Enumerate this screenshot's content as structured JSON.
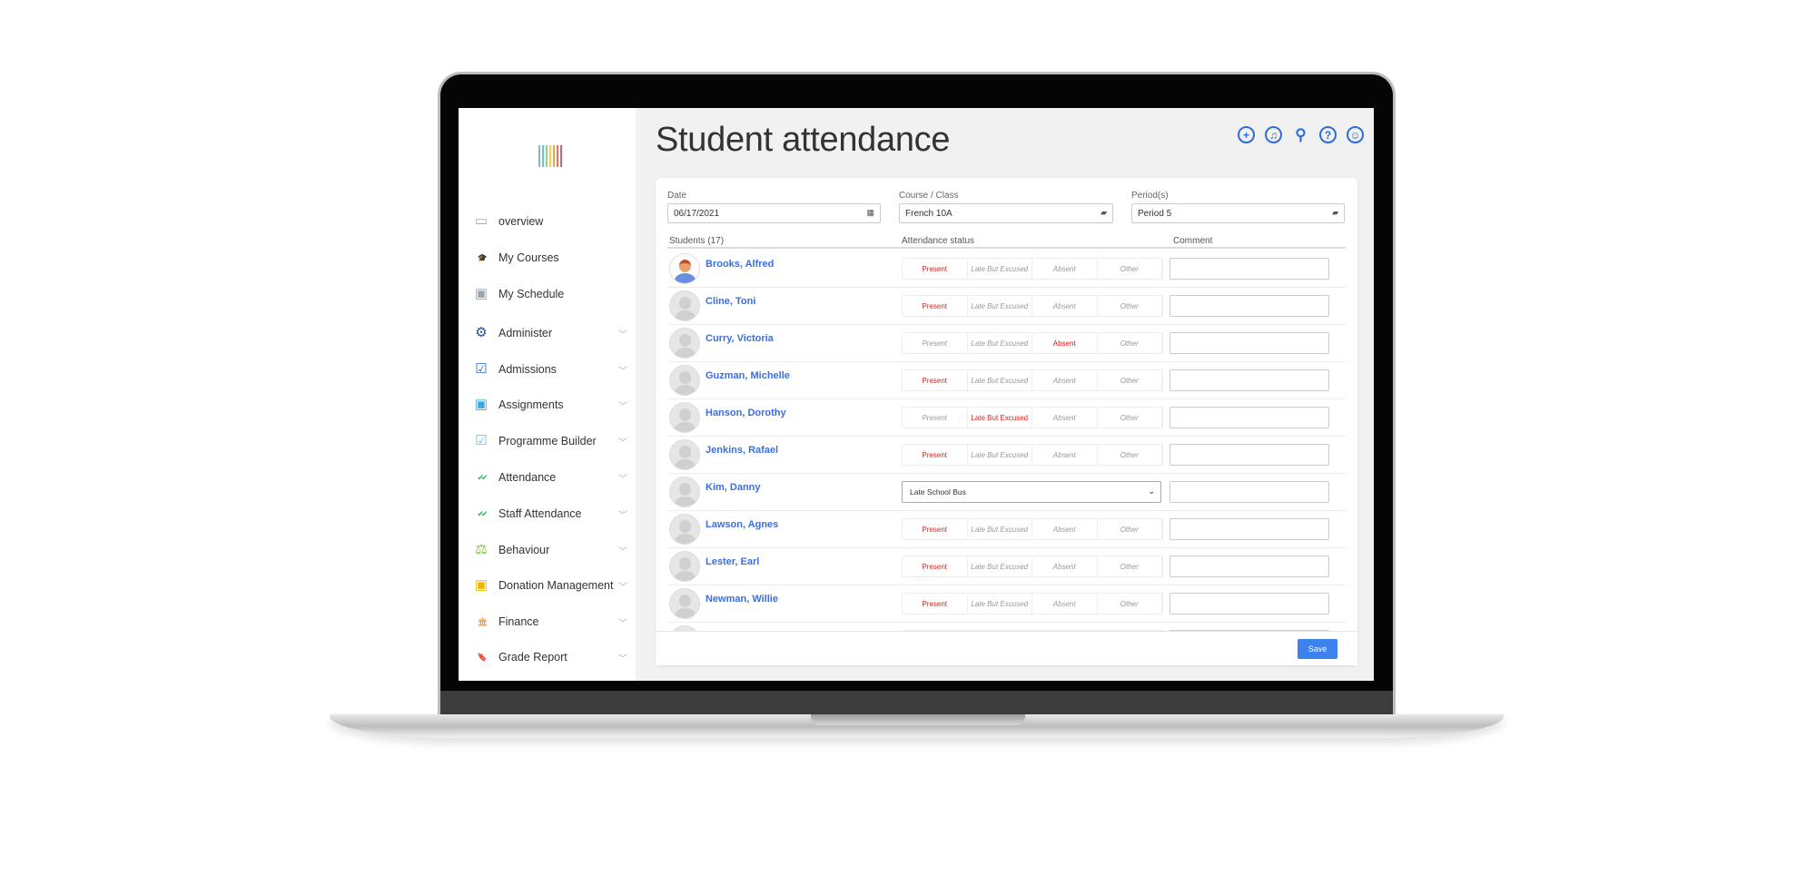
{
  "sidebar": {
    "logo_colors": [
      "#7fb3e8",
      "#5fc7d8",
      "#9bd37a",
      "#f0d050",
      "#f0a050",
      "#e87060",
      "#d06080"
    ],
    "items": [
      {
        "label": "overview",
        "icon": "monitor-icon",
        "glyph": "▭",
        "color": "#9aa4b0",
        "chevron": false
      },
      {
        "label": "My Courses",
        "icon": "graduation-cap-icon",
        "glyph": "🎓",
        "color": "#9aa4b0",
        "chevron": false
      },
      {
        "label": "My Schedule",
        "icon": "calendar-icon",
        "glyph": "▣",
        "color": "#9aa4b0",
        "chevron": false
      },
      {
        "label": "Administer",
        "icon": "gear-icon",
        "glyph": "⚙",
        "color": "#1f4f9a",
        "chevron": true
      },
      {
        "label": "Admissions",
        "icon": "clipboard-check-icon",
        "glyph": "☑",
        "color": "#2e6fd0",
        "chevron": true
      },
      {
        "label": "Assignments",
        "icon": "badge-icon",
        "glyph": "▣",
        "color": "#3aa8d8",
        "chevron": true
      },
      {
        "label": "Programme Builder",
        "icon": "clipboard-check-icon",
        "glyph": "☑",
        "color": "#5ec2ec",
        "chevron": true
      },
      {
        "label": "Attendance",
        "icon": "double-check-icon",
        "glyph": "✔✔",
        "color": "#2cb85c",
        "chevron": true
      },
      {
        "label": "Staff Attendance",
        "icon": "double-check-icon",
        "glyph": "✔✔",
        "color": "#2cb85c",
        "chevron": true
      },
      {
        "label": "Behaviour",
        "icon": "gavel-icon",
        "glyph": "⚖",
        "color": "#7cc520",
        "chevron": true
      },
      {
        "label": "Donation Management",
        "icon": "wallet-icon",
        "glyph": "▣",
        "color": "#e8b800",
        "chevron": true
      },
      {
        "label": "Finance",
        "icon": "bank-icon",
        "glyph": "🏛",
        "color": "#e8800a",
        "chevron": true
      },
      {
        "label": "Grade Report",
        "icon": "bookmark-icon",
        "glyph": "🔖",
        "color": "#e06020",
        "chevron": true
      }
    ]
  },
  "header": {
    "title": "Student attendance",
    "icons": [
      "add-icon",
      "notification-icon",
      "search-icon",
      "help-icon",
      "account-icon"
    ]
  },
  "filters": {
    "date": {
      "label": "Date",
      "value": "06/17/2021"
    },
    "course": {
      "label": "Course / Class",
      "value": "French 10A"
    },
    "period": {
      "label": "Period(s)",
      "value": "Period 5"
    }
  },
  "table": {
    "students_header": "Students (17)",
    "status_header": "Attendance status",
    "comment_header": "Comment",
    "status_options": [
      "Present",
      "Late But Excused",
      "Absent",
      "Other"
    ],
    "rows": [
      {
        "name": "Brooks, Alfred",
        "status": "Present",
        "photo": true
      },
      {
        "name": "Cline, Toni",
        "status": "Present"
      },
      {
        "name": "Curry, Victoria",
        "status": "Absent"
      },
      {
        "name": "Guzman, Michelle",
        "status": "Present"
      },
      {
        "name": "Hanson, Dorothy",
        "status": "Late But Excused"
      },
      {
        "name": "Jenkins, Rafael",
        "status": "Present"
      },
      {
        "name": "Kim, Danny",
        "select": "Late School Bus"
      },
      {
        "name": "Lawson, Agnes",
        "status": "Present"
      },
      {
        "name": "Lester, Earl",
        "status": "Present"
      },
      {
        "name": "Newman, Willie",
        "status": "Present"
      },
      {
        "name": "",
        "status": ""
      }
    ]
  },
  "footer": {
    "save_label": "Save"
  },
  "colors": {
    "accent": "#3b82ee",
    "link": "#3b6fe0",
    "selected_status": "#e0201b"
  }
}
